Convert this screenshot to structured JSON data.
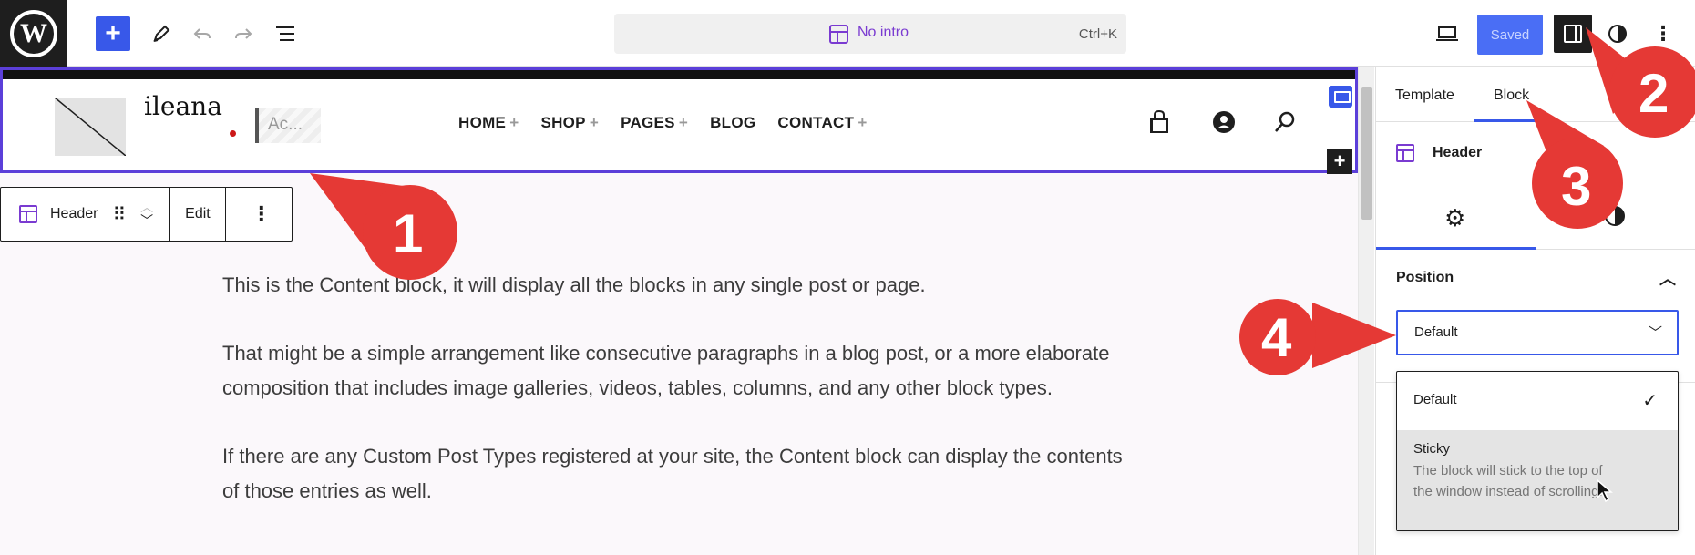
{
  "topbar": {
    "command_title": "No intro",
    "command_shortcut": "Ctrl+K",
    "saved_label": "Saved"
  },
  "site_header": {
    "site_title": "ileana",
    "search_placeholder": "Ac...",
    "nav_items": [
      {
        "label": "HOME",
        "has_submenu": true
      },
      {
        "label": "SHOP",
        "has_submenu": true
      },
      {
        "label": "PAGES",
        "has_submenu": true
      },
      {
        "label": "BLOG",
        "has_submenu": false
      },
      {
        "label": "CONTACT",
        "has_submenu": true
      }
    ]
  },
  "block_toolbar": {
    "block_label": "Header",
    "edit_label": "Edit"
  },
  "content": {
    "paragraphs": [
      "This is the Content block, it will display all the blocks in any single post or page.",
      "That might be a simple arrangement like consecutive paragraphs in a blog post, or a more elaborate composition that includes image galleries, videos, tables, columns, and any other block types.",
      "If there are any Custom Post Types registered at your site, the Content block can display the contents of those entries as well."
    ]
  },
  "sidebar": {
    "tabs": [
      "Template",
      "Block"
    ],
    "active_tab": "Block",
    "block_name": "Header",
    "position_title": "Position",
    "position_value": "Default",
    "options": [
      {
        "label": "Default",
        "selected": true
      },
      {
        "label": "Sticky",
        "description": "The block will stick to the top of the window instead of scrolling."
      }
    ]
  },
  "annotations": [
    "1",
    "2",
    "3",
    "4"
  ],
  "colors": {
    "accent": "#3858e9",
    "header_border": "#5b3fd9",
    "template_icon": "#7a3bd1",
    "annotation": "#e53935"
  }
}
